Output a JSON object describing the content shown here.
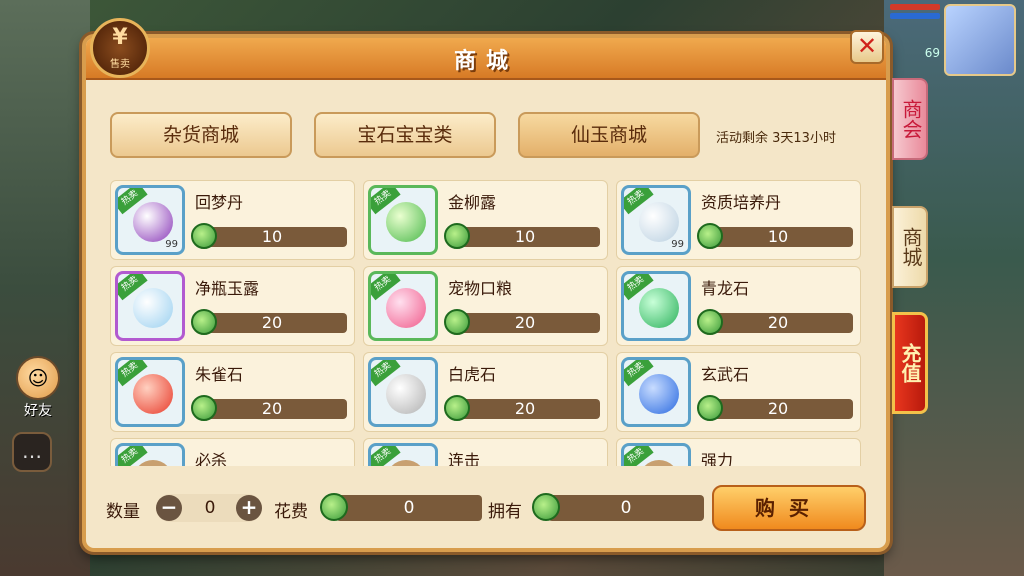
{
  "window": {
    "title": "商城",
    "logo_text": "售卖"
  },
  "categories": [
    {
      "label": "杂货商城",
      "active": false
    },
    {
      "label": "宝石宝宝类",
      "active": false
    },
    {
      "label": "仙玉商城",
      "active": true
    }
  ],
  "event_remaining": "活动剩余 3天13小时",
  "badge_text": "热卖",
  "items": [
    {
      "name": "回梦丹",
      "price": "10",
      "count": "99",
      "color": "#8a3ab8"
    },
    {
      "name": "金柳露",
      "price": "10",
      "count": "",
      "color": "#4ab84a"
    },
    {
      "name": "资质培养丹",
      "price": "10",
      "count": "99",
      "color": "#dfeaf2"
    },
    {
      "name": "净瓶玉露",
      "price": "20",
      "count": "",
      "color": "#9ad0f0"
    },
    {
      "name": "宠物口粮",
      "price": "20",
      "count": "",
      "color": "#f05a8a"
    },
    {
      "name": "青龙石",
      "price": "20",
      "count": "",
      "color": "#2ab05a"
    },
    {
      "name": "朱雀石",
      "price": "20",
      "count": "",
      "color": "#e83a2a"
    },
    {
      "name": "白虎石",
      "price": "20",
      "count": "",
      "color": "#cfcfcf"
    },
    {
      "name": "玄武石",
      "price": "20",
      "count": "",
      "color": "#2a6ae0"
    },
    {
      "name": "必杀",
      "price": "",
      "count": "",
      "color": "#c8a070"
    },
    {
      "name": "连击",
      "price": "",
      "count": "",
      "color": "#c8a070"
    },
    {
      "name": "强力",
      "price": "",
      "count": "",
      "color": "#c8a070"
    }
  ],
  "bottom": {
    "qty_label": "数量",
    "qty_value": "0",
    "minus": "−",
    "plus": "+",
    "cost_label": "花费",
    "cost_value": "0",
    "own_label": "拥有",
    "own_value": "0",
    "buy_label": "购买"
  },
  "side_tabs": {
    "shanghui": "商会",
    "shangcheng": "商城",
    "chongzhi": "充值"
  },
  "side_left": {
    "friend_label": "好友"
  },
  "player": {
    "level": "69"
  }
}
